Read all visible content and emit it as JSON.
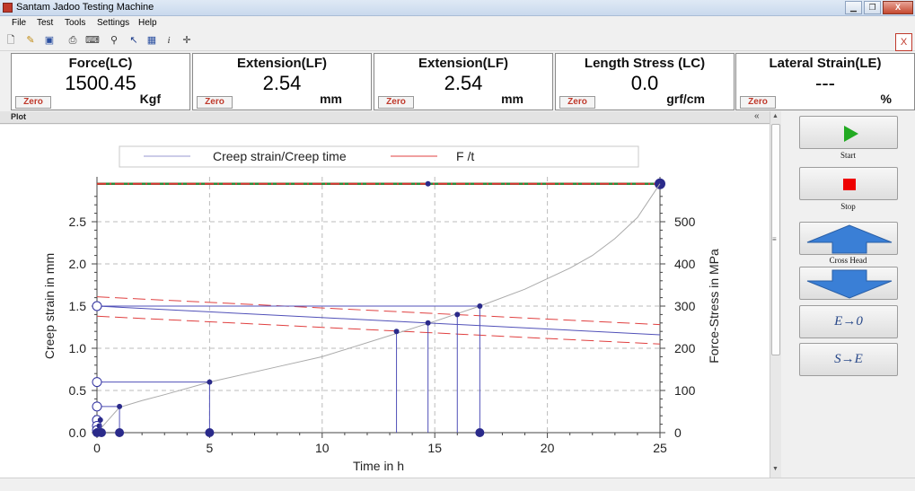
{
  "window": {
    "title": "Santam Jadoo Testing Machine",
    "close_label": "X"
  },
  "menu": [
    "File",
    "Test",
    "Tools",
    "Settings",
    "Help"
  ],
  "toolbar": {
    "close_label": "X"
  },
  "readouts": [
    {
      "title": "Force(LC)",
      "value": "1500.45",
      "unit": "Kgf",
      "zero": "Zero"
    },
    {
      "title": "Extension(LF)",
      "value": "2.54",
      "unit": "mm",
      "zero": "Zero"
    },
    {
      "title": "Extension(LF)",
      "value": "2.54",
      "unit": "mm",
      "zero": "Zero"
    },
    {
      "title": "Length Stress (LC)",
      "value": "0.0",
      "unit": "grf/cm",
      "zero": "Zero"
    },
    {
      "title": "Lateral Strain(LE)",
      "value": "---",
      "unit": "%",
      "zero": "Zero"
    }
  ],
  "plot": {
    "header": "Plot"
  },
  "controls": {
    "start_label": "Start",
    "stop_label": "Stop",
    "crosshead_label": "Cross Head",
    "e_zero": "E→0",
    "s_e": "S→E"
  },
  "colors": {
    "start_green": "#22aa22",
    "stop_red": "#ee0000",
    "arrow_blue": "#3a7fd6",
    "series_blue": "#3030a0",
    "series_red": "#e04040"
  },
  "chart_data": {
    "type": "line",
    "xlabel": "Time in h",
    "ylabel": "Creep strain in mm",
    "y2label": "Force-Stress in MPa",
    "xlim": [
      0,
      25
    ],
    "ylim": [
      0,
      3.0
    ],
    "y2lim": [
      0,
      600
    ],
    "xticks": [
      0,
      5,
      10,
      15,
      20,
      25
    ],
    "yticks": [
      0.0,
      0.5,
      1.0,
      1.5,
      2.0,
      2.5
    ],
    "y2ticks": [
      0,
      100,
      200,
      300,
      400,
      500
    ],
    "grid": true,
    "legend": {
      "placement": "top",
      "entries": [
        "Creep strain/Creep time",
        "F /t"
      ]
    },
    "series": [
      {
        "name": "Creep strain/Creep time",
        "curve": [
          [
            0,
            0
          ],
          [
            0.5,
            0.15
          ],
          [
            1,
            0.3
          ],
          [
            2,
            0.38
          ],
          [
            3,
            0.45
          ],
          [
            5,
            0.6
          ],
          [
            8,
            0.78
          ],
          [
            10,
            0.9
          ],
          [
            13,
            1.15
          ],
          [
            15,
            1.32
          ],
          [
            17,
            1.5
          ],
          [
            19,
            1.7
          ],
          [
            21,
            1.95
          ],
          [
            22,
            2.1
          ],
          [
            23,
            2.3
          ],
          [
            24,
            2.55
          ],
          [
            25,
            2.95
          ]
        ]
      },
      {
        "name": "F /t"
      }
    ],
    "stems": [
      [
        0,
        0.02
      ],
      [
        0.1,
        0.08
      ],
      [
        0.15,
        0.15
      ],
      [
        1,
        0.31
      ],
      [
        5,
        0.6
      ],
      [
        13.3,
        1.2
      ],
      [
        14.7,
        1.3
      ],
      [
        16,
        1.4
      ],
      [
        17,
        1.5
      ]
    ],
    "horizontal_markers": [
      0.15,
      0.31,
      0.6,
      1.5
    ],
    "blue_line": [
      [
        0,
        1.5
      ],
      [
        25,
        1.16
      ]
    ],
    "red_dashed_lines": [
      [
        [
          0,
          1.61
        ],
        [
          25,
          1.28
        ]
      ],
      [
        [
          0,
          1.38
        ],
        [
          25,
          1.05
        ]
      ]
    ],
    "top_line_level": 2.95,
    "top_marker_x": 14.7,
    "bottom_markers": [
      0,
      0.2,
      1,
      5,
      17
    ]
  }
}
